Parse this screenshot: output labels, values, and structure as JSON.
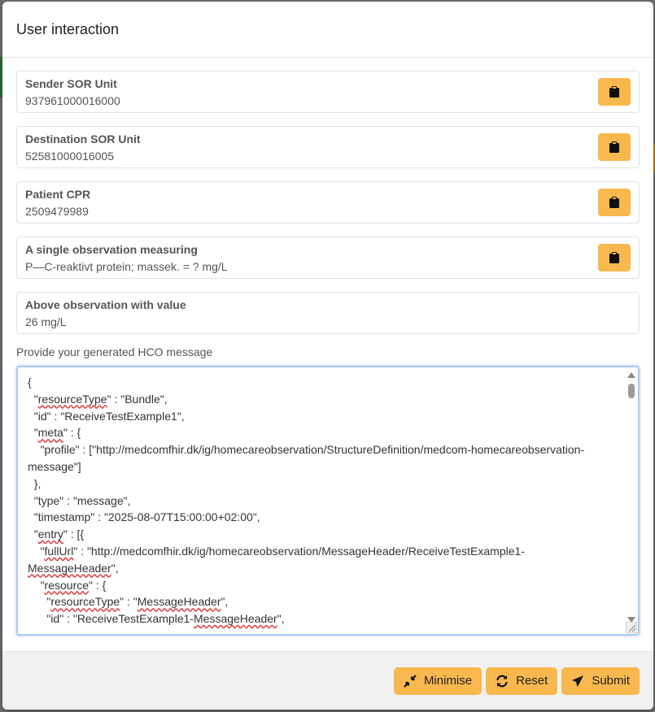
{
  "modal": {
    "title": "User interaction"
  },
  "fields": [
    {
      "label": "Sender SOR Unit",
      "value": "937961000016000",
      "copy": true
    },
    {
      "label": "Destination SOR Unit",
      "value": "52581000016005",
      "copy": true
    },
    {
      "label": "Patient CPR",
      "value": "2509479989",
      "copy": true
    },
    {
      "label": "A single observation measuring",
      "value": "P—C-reaktivt protein; massek. = ? mg/L",
      "copy": true
    },
    {
      "label": "Above observation with value",
      "value": "26 mg/L",
      "copy": false
    }
  ],
  "hco": {
    "label": "Provide your generated HCO message",
    "text": "{\n  \"resourceType\" : \"Bundle\",\n  \"id\" : \"ReceiveTestExample1\",\n  \"meta\" : {\n    \"profile\" : [\"http://medcomfhir.dk/ig/homecareobservation/StructureDefinition/medcom-homecareobservation-message\"]\n  },\n  \"type\" : \"message\",\n  \"timestamp\" : \"2025-08-07T15:00:00+02:00\",\n  \"entry\" : [{\n    \"fullUrl\" : \"http://medcomfhir.dk/ig/homecareobservation/MessageHeader/ReceiveTestExample1-MessageHeader\",\n    \"resource\" : {\n      \"resourceType\" : \"MessageHeader\",\n      \"id\" : \"ReceiveTestExample1-MessageHeader\","
  },
  "footer": {
    "minimise_label": "Minimise",
    "reset_label": "Reset",
    "submit_label": "Submit"
  },
  "colors": {
    "accent": "#f8b84e",
    "footer_bg": "#f1f1f1",
    "focus_border": "#a9c8ee"
  },
  "icons": {
    "copy": "clipboard-icon",
    "minimise": "compress-arrows-icon",
    "reset": "refresh-icon",
    "submit": "paper-plane-icon"
  }
}
